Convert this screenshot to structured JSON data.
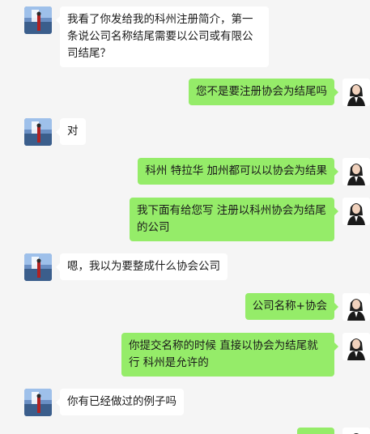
{
  "colors": {
    "background": "#f5f5f5",
    "incoming_bubble": "#ffffff",
    "outgoing_bubble": "#95ec69"
  },
  "messages": [
    {
      "side": "left",
      "avatar": "landscape-avatar",
      "text": "我看了你发给我的科州注册简介，第一条说公司名称结尾需要以公司或有限公司结尾？"
    },
    {
      "side": "right",
      "avatar": "businesswoman-avatar",
      "text": "您不是要注册协会为结尾吗"
    },
    {
      "side": "left",
      "avatar": "landscape-avatar",
      "text": "对"
    },
    {
      "side": "right",
      "avatar": "businesswoman-avatar",
      "text": "科州 特拉华 加州都可以以协会为结果"
    },
    {
      "side": "right",
      "avatar": "businesswoman-avatar",
      "text": "我下面有给您写  注册以科州协会为结尾的公司"
    },
    {
      "side": "left",
      "avatar": "landscape-avatar",
      "text": "嗯，我以为要整成什么协会公司"
    },
    {
      "side": "right",
      "avatar": "businesswoman-avatar",
      "text": "公司名称+协会"
    },
    {
      "side": "right",
      "avatar": "businesswoman-avatar",
      "text": "你提交名称的时候 直接以协会为结尾就行   科州是允许的"
    },
    {
      "side": "left",
      "avatar": "landscape-avatar",
      "text": "你有已经做过的例子吗"
    },
    {
      "side": "right",
      "avatar": "businesswoman-avatar",
      "text": ""
    }
  ]
}
